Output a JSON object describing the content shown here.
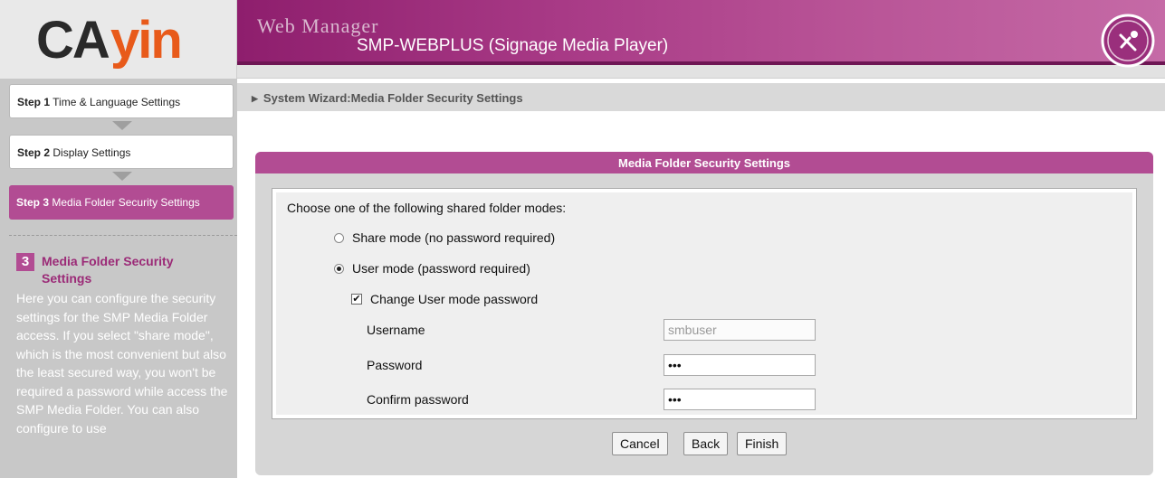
{
  "header": {
    "logo_text": "CAYIN",
    "title": "Web Manager",
    "subtitle": "SMP-WEBPLUS (Signage Media Player)",
    "power_icon": "power-icon"
  },
  "sidebar": {
    "steps": [
      {
        "num": "Step 1",
        "label": "Time & Language Settings",
        "active": false
      },
      {
        "num": "Step 2",
        "label": "Display Settings",
        "active": false
      },
      {
        "num": "Step 3",
        "label": "Media Folder Security Settings",
        "active": true
      }
    ],
    "help": {
      "number": "3",
      "title": "Media Folder Security Settings",
      "text": "Here you can configure the security settings for the SMP Media Folder access. If you select \"share mode\", which is the most convenient but also the least secured way, you won't be required a password while access the SMP Media Folder. You can also configure to use"
    }
  },
  "breadcrumb": "System Wizard:Media Folder Security Settings",
  "panel": {
    "title": "Media Folder Security Settings",
    "prompt": "Choose one of the following shared folder modes:",
    "options": [
      {
        "label": "Share mode (no password required)",
        "checked": false
      },
      {
        "label": "User mode (password required)",
        "checked": true
      }
    ],
    "change_password": {
      "label": "Change User mode password",
      "checked": true
    },
    "fields": {
      "username": {
        "label": "Username",
        "value": "smbuser"
      },
      "password": {
        "label": "Password",
        "value": "•••"
      },
      "confirm": {
        "label": "Confirm password",
        "value": "•••"
      }
    }
  },
  "buttons": {
    "cancel": "Cancel",
    "back": "Back",
    "finish": "Finish"
  },
  "colors": {
    "accent": "#b24c93",
    "header_band": "#a83a86",
    "sidebar_bg": "#c8c8c8"
  }
}
